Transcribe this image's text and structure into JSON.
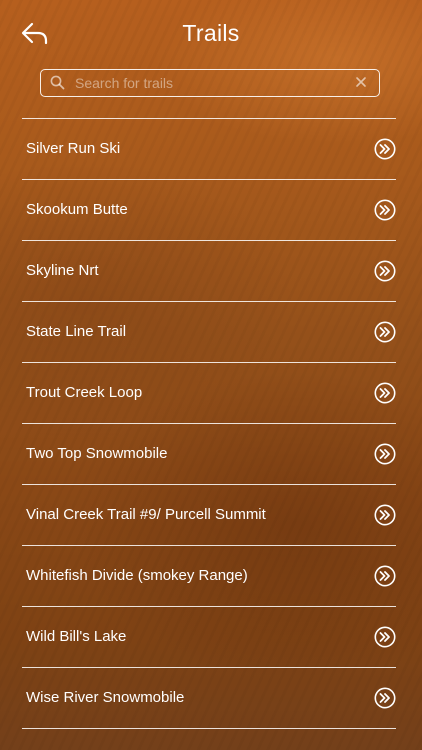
{
  "header": {
    "title": "Trails",
    "back_icon": "back-arrow-icon"
  },
  "search": {
    "placeholder": "Search for trails",
    "value": "",
    "search_icon": "magnifier-icon",
    "clear_icon": "clear-x-icon"
  },
  "trails": [
    {
      "label": "Silver Run Ski"
    },
    {
      "label": "Skookum Butte"
    },
    {
      "label": "Skyline Nrt"
    },
    {
      "label": "State Line Trail"
    },
    {
      "label": "Trout Creek Loop"
    },
    {
      "label": "Two Top Snowmobile"
    },
    {
      "label": "Vinal Creek Trail #9/ Purcell Summit"
    },
    {
      "label": "Whitefish Divide (smokey Range)"
    },
    {
      "label": "Wild Bill's Lake"
    },
    {
      "label": "Wise River Snowmobile"
    }
  ],
  "row_icon": "double-chevron-right-circle-icon",
  "colors": {
    "background": "#a4561a",
    "foreground": "#ffffff"
  }
}
